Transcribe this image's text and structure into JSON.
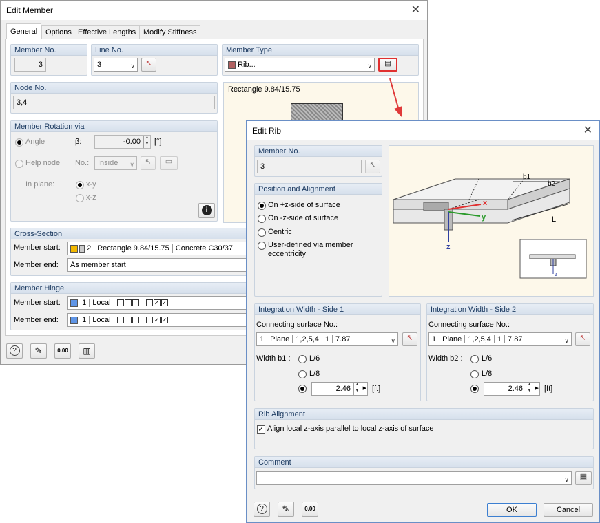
{
  "main": {
    "title": "Edit Member",
    "tabs": [
      "General",
      "Options",
      "Effective Lengths",
      "Modify Stiffness"
    ],
    "member_no": {
      "title": "Member No.",
      "value": "3"
    },
    "line_no": {
      "title": "Line No.",
      "value": "3"
    },
    "member_type": {
      "title": "Member Type",
      "value": "Rib...",
      "color": "#b06060"
    },
    "node_no": {
      "title": "Node No.",
      "value": "3,4"
    },
    "section_preview": "Rectangle 9.84/15.75",
    "rotation": {
      "title": "Member Rotation via",
      "angle": "Angle",
      "beta": "β:",
      "beta_value": "-0.00",
      "unit": "[°]",
      "help_node": "Help node",
      "no": "No.:",
      "no_value": "Inside",
      "in_plane": "In plane:",
      "xy": "x-y",
      "xz": "x-z"
    },
    "cross_section": {
      "title": "Cross-Section",
      "start_label": "Member start:",
      "start_no": "2",
      "start_name": "Rectangle 9.84/15.75",
      "start_mat": "Concrete C30/37",
      "end_label": "Member end:",
      "end_value": "As member start"
    },
    "hinge": {
      "title": "Member Hinge",
      "start_label": "Member start:",
      "end_label": "Member end:",
      "no": "1",
      "sys": "Local"
    }
  },
  "rib": {
    "title": "Edit Rib",
    "member_no": {
      "title": "Member No.",
      "value": "3"
    },
    "position": {
      "title": "Position and Alignment",
      "options": [
        "On +z-side of surface",
        "On -z-side of surface",
        "Centric",
        "User-defined via member eccentricity"
      ]
    },
    "diagram": {
      "b1": "b1",
      "b2": "b2",
      "L": "L",
      "x": "x",
      "y": "y",
      "z": "z"
    },
    "side1": {
      "title": "Integration Width - Side 1",
      "conn_label": "Connecting surface No.:",
      "c1": "1",
      "c2": "Plane",
      "c3": "1,2,5,4",
      "c4": "1",
      "c5": "7.87",
      "width_label": "Width b1 :",
      "opt1": "L/6",
      "opt2": "L/8",
      "value": "2.46",
      "unit": "[ft]"
    },
    "side2": {
      "title": "Integration Width - Side 2",
      "conn_label": "Connecting surface No.:",
      "c1": "1",
      "c2": "Plane",
      "c3": "1,2,5,4",
      "c4": "1",
      "c5": "7.87",
      "width_label": "Width b2 :",
      "opt1": "L/6",
      "opt2": "L/8",
      "value": "2.46",
      "unit": "[ft]"
    },
    "alignment": {
      "title": "Rib Alignment",
      "check_label": "Align local z-axis parallel to local z-axis of surface"
    },
    "comment": {
      "title": "Comment",
      "value": ""
    },
    "ok": "OK",
    "cancel": "Cancel"
  }
}
